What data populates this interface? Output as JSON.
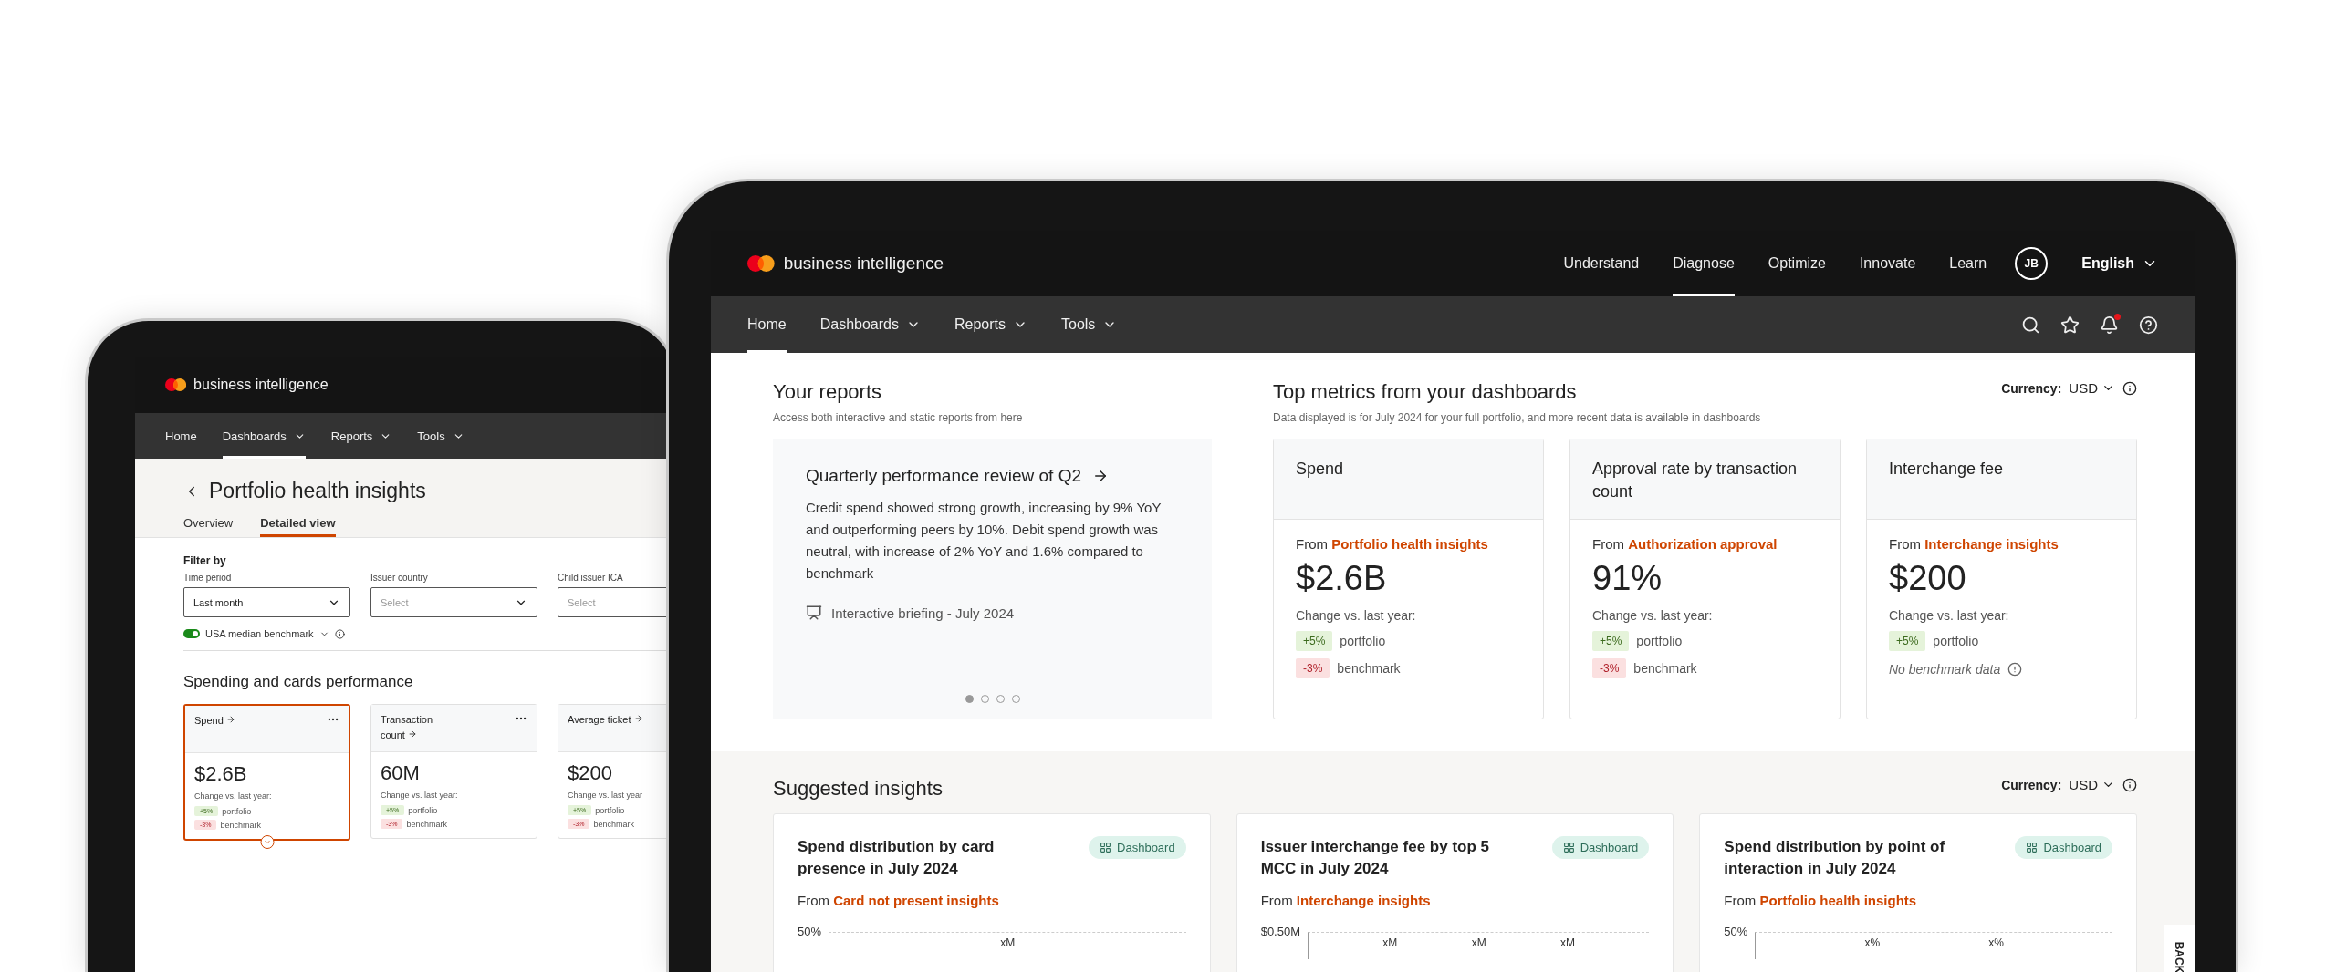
{
  "left_screen": {
    "brand": "business intelligence",
    "nav": [
      {
        "label": "Home",
        "selected": false,
        "has_menu": false
      },
      {
        "label": "Dashboards",
        "selected": true,
        "has_menu": true
      },
      {
        "label": "Reports",
        "selected": false,
        "has_menu": true
      },
      {
        "label": "Tools",
        "selected": false,
        "has_menu": true
      }
    ],
    "page_title": "Portfolio health insights",
    "tabs": [
      {
        "label": "Overview",
        "selected": false
      },
      {
        "label": "Detailed view",
        "selected": true
      }
    ],
    "filter_heading": "Filter by",
    "filters": [
      {
        "label": "Time period",
        "value": "Last month"
      },
      {
        "label": "Issuer country",
        "placeholder": "Select"
      },
      {
        "label": "Child issuer ICA",
        "placeholder": "Select"
      }
    ],
    "benchmark_toggle": {
      "label": "USA median benchmark",
      "on": true
    },
    "section_title": "Spending and cards performance",
    "cards": [
      {
        "title": "Spend",
        "selected": true,
        "has_menu": true,
        "value": "$2.6B",
        "change_label": "Change vs. last year:",
        "changes": [
          {
            "kind": "positive",
            "badge": "+5%",
            "label": "portfolio"
          },
          {
            "kind": "negative",
            "badge": "-3%",
            "label": "benchmark"
          }
        ]
      },
      {
        "title": "Transaction count",
        "selected": false,
        "has_menu": true,
        "value": "60M",
        "change_label": "Change vs. last year:",
        "changes": [
          {
            "kind": "positive",
            "badge": "+5%",
            "label": "portfolio"
          },
          {
            "kind": "negative",
            "badge": "-3%",
            "label": "benchmark"
          }
        ]
      },
      {
        "title": "Average ticket",
        "selected": false,
        "value": "$200",
        "change_label": "Change vs. last year",
        "changes": [
          {
            "kind": "positive",
            "badge": "+5%",
            "label": "portfolio"
          },
          {
            "kind": "negative",
            "badge": "-3%",
            "label": "benchmark"
          }
        ]
      }
    ]
  },
  "right_screen": {
    "brand": "business intelligence",
    "top_links": [
      {
        "label": "Understand",
        "selected": false
      },
      {
        "label": "Diagnose",
        "selected": true
      },
      {
        "label": "Optimize",
        "selected": false
      },
      {
        "label": "Innovate",
        "selected": false
      },
      {
        "label": "Learn",
        "selected": false
      }
    ],
    "avatar": "JB",
    "language": "English",
    "nav": [
      {
        "label": "Home",
        "selected": true,
        "has_menu": false
      },
      {
        "label": "Dashboards",
        "selected": false,
        "has_menu": true
      },
      {
        "label": "Reports",
        "selected": false,
        "has_menu": true
      },
      {
        "label": "Tools",
        "selected": false,
        "has_menu": true
      }
    ],
    "notifications_unread": true,
    "reports": {
      "title": "Your reports",
      "subtitle": "Access both interactive and static reports from here",
      "card": {
        "title": "Quarterly performance review of Q2",
        "body": "Credit spend showed strong growth, increasing by 9% YoY and outperforming peers by 10%. Debit spend growth was neutral, with increase of 2% YoY and 1.6% compared to benchmark",
        "footer": "Interactive briefing - July 2024",
        "pages": [
          {
            "selected": true
          },
          {
            "selected": false
          },
          {
            "selected": false
          },
          {
            "selected": false
          }
        ]
      }
    },
    "metrics": {
      "title": "Top metrics from your dashboards",
      "subtitle": "Data displayed is for July 2024 for your full portfolio, and more recent data is available in dashboards",
      "currency_label": "Currency:",
      "currency": "USD",
      "cards": [
        {
          "title": "Spend",
          "source_prefix": "From",
          "source": "Portfolio health insights",
          "value": "$2.6B",
          "change_label": "Change vs. last year:",
          "changes": [
            {
              "kind": "positive",
              "badge": "+5%",
              "label": "portfolio"
            },
            {
              "kind": "negative",
              "badge": "-3%",
              "label": "benchmark"
            }
          ]
        },
        {
          "title": "Approval rate by transaction count",
          "source_prefix": "From",
          "source": "Authorization approval",
          "value": "91%",
          "change_label": "Change vs. last year:",
          "changes": [
            {
              "kind": "positive",
              "badge": "+5%",
              "label": "portfolio"
            },
            {
              "kind": "negative",
              "badge": "-3%",
              "label": "benchmark"
            }
          ]
        },
        {
          "title": "Interchange fee",
          "source_prefix": "From",
          "source": "Interchange insights",
          "value": "$200",
          "change_label": "Change vs. last year:",
          "changes": [
            {
              "kind": "positive",
              "badge": "+5%",
              "label": "portfolio"
            },
            {
              "kind": "missing",
              "label": "No benchmark data"
            }
          ]
        }
      ]
    },
    "insights": {
      "title": "Suggested insights",
      "currency_label": "Currency:",
      "currency": "USD",
      "cards": [
        {
          "title": "Spend distribution by card presence in July 2024",
          "tag": "Dashboard",
          "source_prefix": "From",
          "source": "Card not present insights",
          "y_tick": "50%",
          "bar_labels": [
            "xM"
          ]
        },
        {
          "title": "Issuer interchange fee by top 5 MCC in July 2024",
          "tag": "Dashboard",
          "source_prefix": "From",
          "source": "Interchange insights",
          "y_tick": "$0.50M",
          "bar_labels": [
            "xM",
            "xM",
            "xM"
          ]
        },
        {
          "title": "Spend distribution by point of interaction in July 2024",
          "tag": "Dashboard",
          "source_prefix": "From",
          "source": "Portfolio health insights",
          "y_tick": "50%",
          "bar_labels": [
            "x%",
            "x%"
          ]
        }
      ]
    },
    "feedback_tab": "BACK"
  }
}
